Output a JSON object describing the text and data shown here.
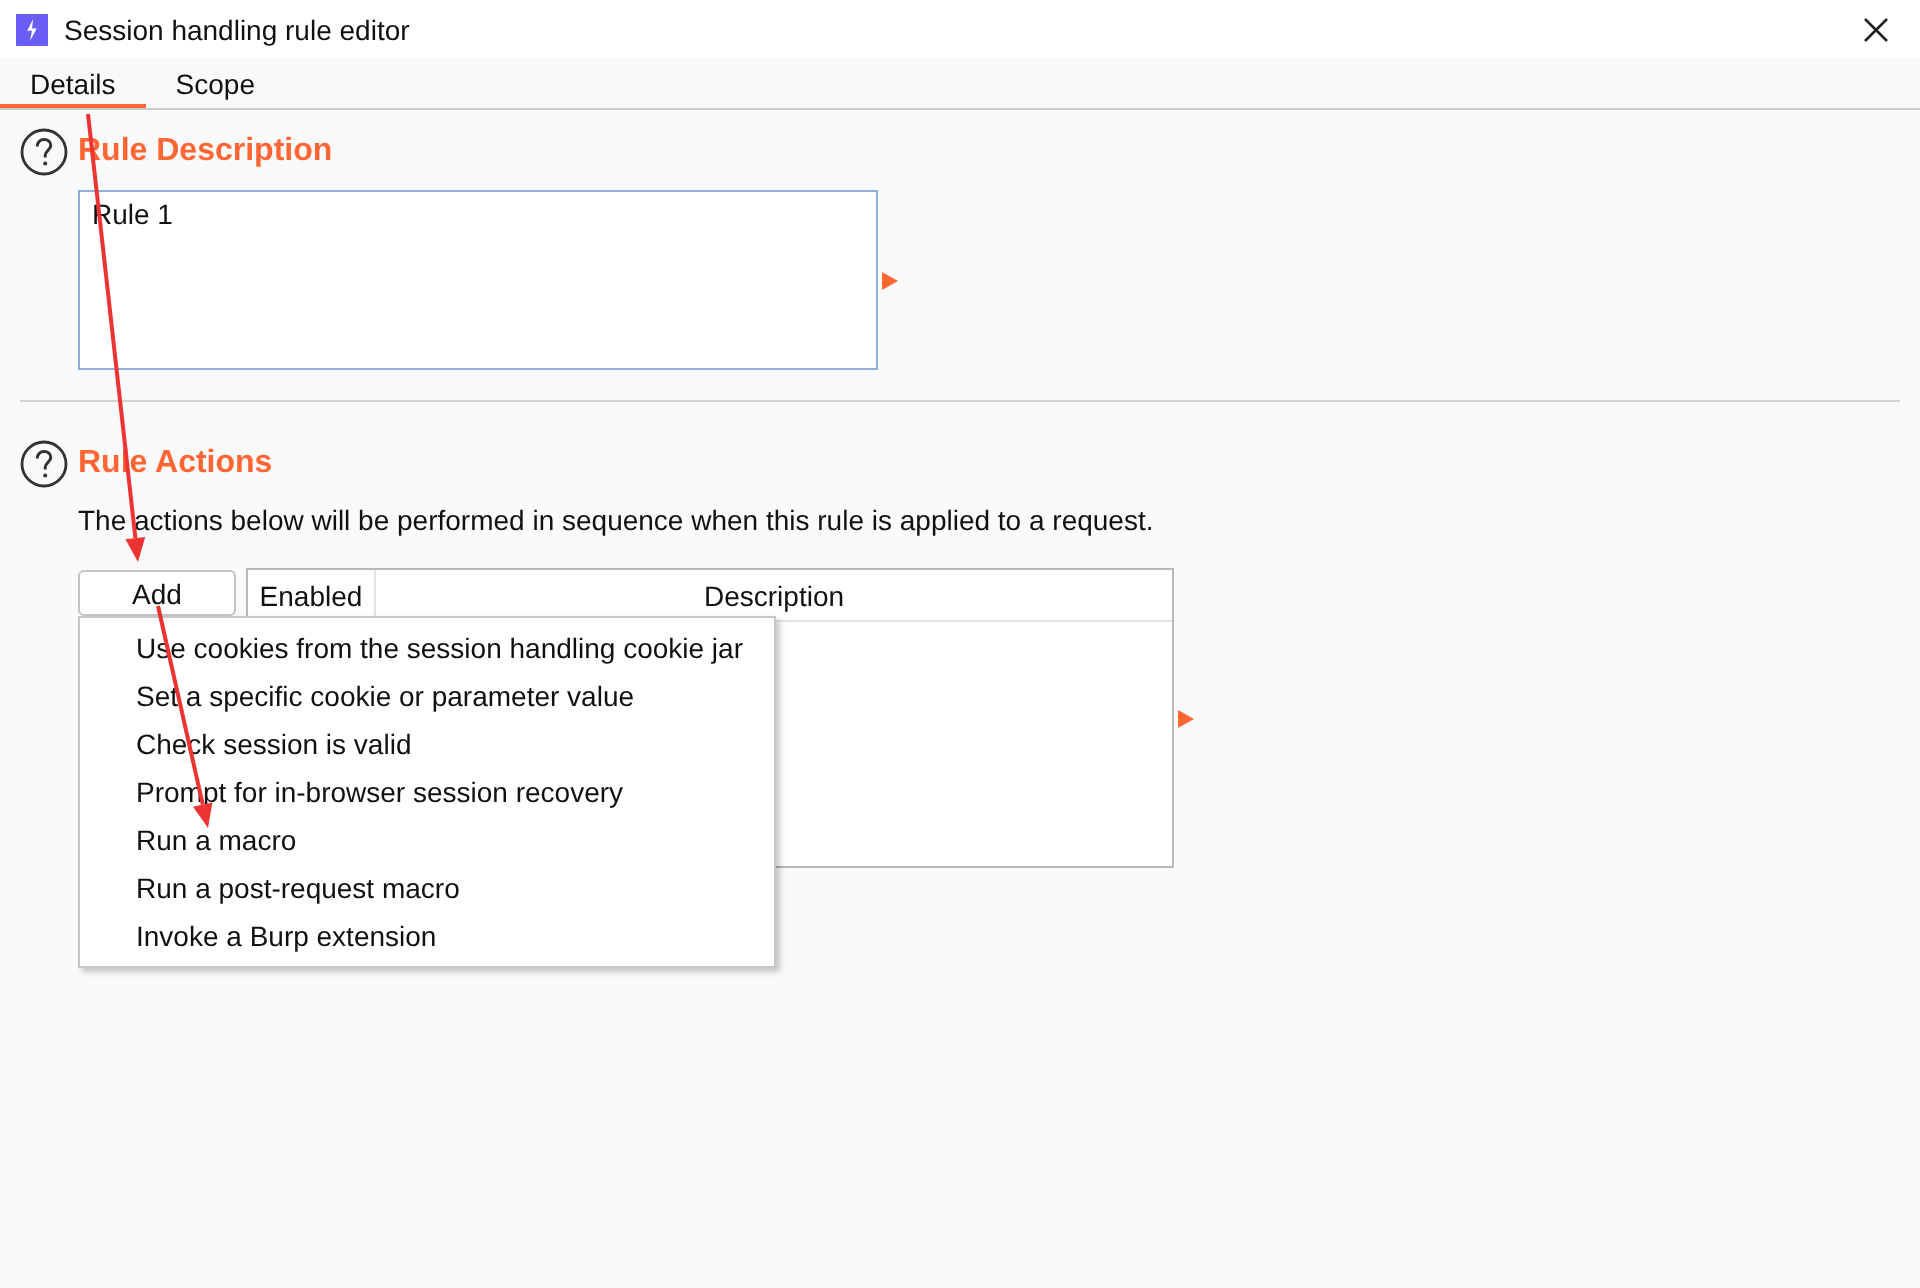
{
  "window": {
    "title": "Session handling rule editor"
  },
  "tabs": [
    {
      "label": "Details",
      "selected": true
    },
    {
      "label": "Scope",
      "selected": false
    }
  ],
  "rule_description": {
    "heading": "Rule Description",
    "value": "Rule 1"
  },
  "rule_actions": {
    "heading": "Rule Actions",
    "intro": "The actions below will be performed in sequence when this rule is applied to a request.",
    "add_button": {
      "label": "Add",
      "expanded": true,
      "menu_items": [
        "Use cookies from the session handling cookie jar",
        "Set a specific cookie or parameter value",
        "Check session is valid",
        "Prompt for in-browser session recovery",
        "Run a macro",
        "Run a post-request macro",
        "Invoke a Burp extension"
      ]
    },
    "table": {
      "columns": [
        "Enabled",
        "Description"
      ]
    }
  }
}
